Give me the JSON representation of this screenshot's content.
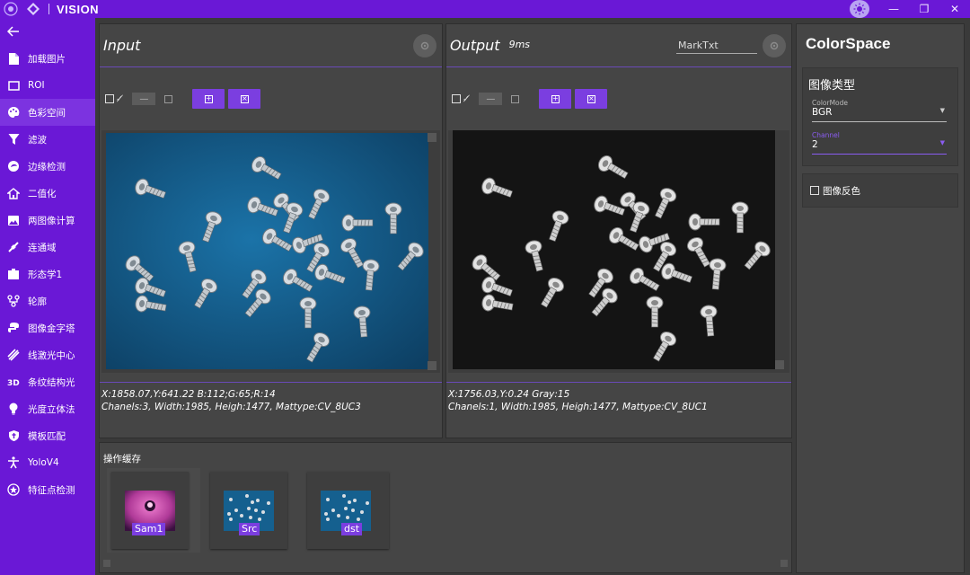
{
  "app": {
    "title": "VISION"
  },
  "sidebar": {
    "items": [
      {
        "label": "加载图片",
        "icon": "file-icon"
      },
      {
        "label": "ROI",
        "icon": "rectangle-icon"
      },
      {
        "label": "色彩空间",
        "icon": "palette-icon",
        "active": true
      },
      {
        "label": "滤波",
        "icon": "filter-icon"
      },
      {
        "label": "边缘检测",
        "icon": "edge-icon"
      },
      {
        "label": "二值化",
        "icon": "home-icon"
      },
      {
        "label": "两图像计算",
        "icon": "image-icon"
      },
      {
        "label": "连通域",
        "icon": "network-icon"
      },
      {
        "label": "形态学1",
        "icon": "shape-icon"
      },
      {
        "label": "轮廓",
        "icon": "contour-icon"
      },
      {
        "label": "图像金字塔",
        "icon": "python-icon"
      },
      {
        "label": "线激光中心",
        "icon": "laser-icon"
      },
      {
        "label": "条纹结构光",
        "icon": "3d-icon"
      },
      {
        "label": "光度立体法",
        "icon": "bulb-icon"
      },
      {
        "label": "模板匹配",
        "icon": "shield-icon"
      },
      {
        "label": "YoloV4",
        "icon": "person-icon"
      },
      {
        "label": "特征点检测",
        "icon": "star-icon"
      }
    ]
  },
  "input_panel": {
    "title": "Input",
    "info_line1": "X:1858.07,Y:641.22    B:112;G:65;R:14",
    "info_line2": "Chanels:3, Width:1985, Heigh:1477, Mattype:CV_8UC3"
  },
  "output_panel": {
    "title": "Output",
    "time": "9ms",
    "mark_placeholder": "MarkTxt",
    "info_line1": "X:1756.03,Y:0.24    Gray:15",
    "info_line2": "Chanels:1, Width:1985, Heigh:1477, Mattype:CV_8UC1"
  },
  "colorspace": {
    "title": "ColorSpace",
    "section_title": "图像类型",
    "colormode_label": "ColorMode",
    "colormode_value": "BGR",
    "channel_label": "Channel",
    "channel_value": "2",
    "invert_label": "图像反色"
  },
  "cache": {
    "title": "操作缓存",
    "items": [
      {
        "label": "Sam1"
      },
      {
        "label": "Src"
      },
      {
        "label": "dst"
      }
    ]
  },
  "colors": {
    "accent": "#6a18d6",
    "panel": "#454545",
    "background": "#3a3a3a"
  }
}
